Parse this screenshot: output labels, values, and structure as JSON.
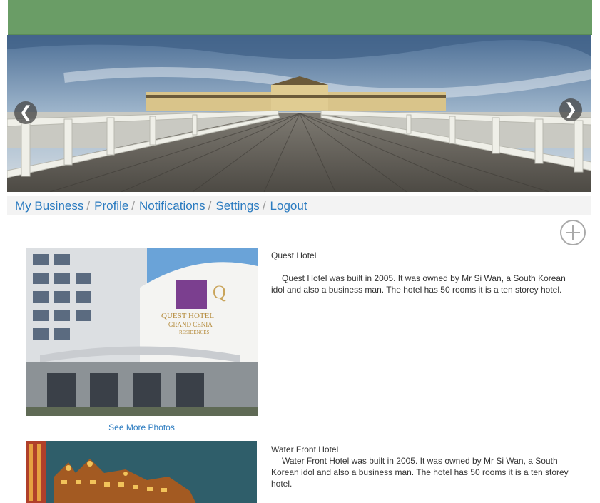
{
  "carousel": {
    "prev_icon": "chevron-left-icon",
    "next_icon": "chevron-right-icon",
    "prev_glyph": "❮",
    "next_glyph": "❯"
  },
  "nav": {
    "items": [
      {
        "label": "My Business",
        "sep": "/"
      },
      {
        "label": "Profile",
        "sep": "/"
      },
      {
        "label": "Notifications",
        "sep": "/"
      },
      {
        "label": "Settings",
        "sep": "/"
      },
      {
        "label": "Logout",
        "sep": ""
      }
    ]
  },
  "actions": {
    "add_icon": "plus-circle-icon"
  },
  "hotels": [
    {
      "name": "Quest Hotel",
      "description": "Quest Hotel was built in 2005. It was owned by Mr Si Wan, a South Korean idol and also a business man. The hotel has 50 rooms it is a ten storey hotel.",
      "see_more": "See More Photos",
      "sign_line1": "QUEST HOTEL",
      "sign_line2": "GRAND CENIA",
      "sign_line3": "RESIDENCES"
    },
    {
      "name": "Water Front Hotel",
      "description": "Water Front  Hotel was built in 2005. It was owned by Mr Si Wan, a South Korean idol and also a business man. The hotel has 50 rooms it is a ten storey hotel."
    }
  ],
  "colors": {
    "header": "#6a9d66",
    "link": "#2b7bc0",
    "nav_bg": "#f3f3f3"
  }
}
